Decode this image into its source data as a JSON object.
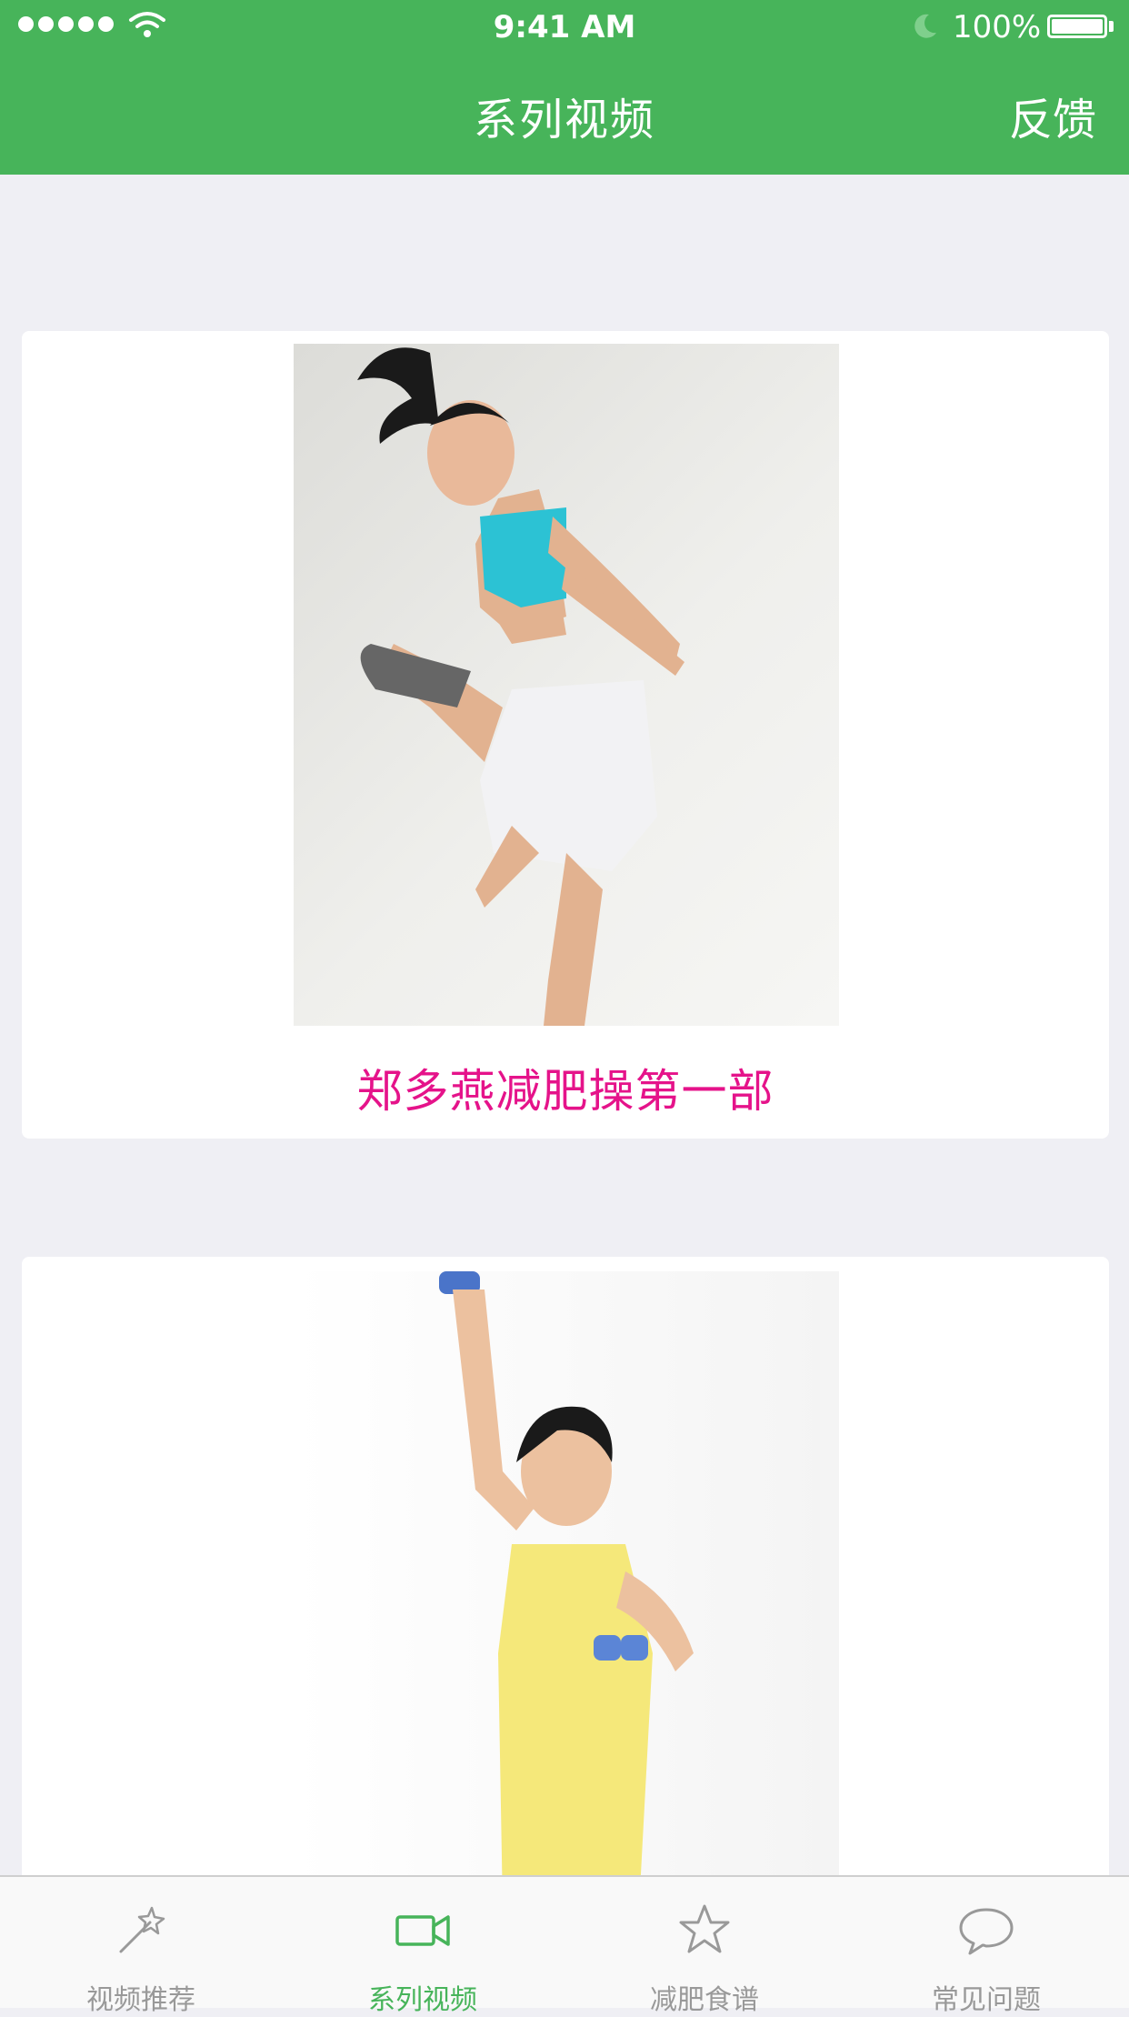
{
  "status_bar": {
    "time": "9:41 AM",
    "battery": "100%"
  },
  "nav": {
    "title": "系列视频",
    "action": "反馈"
  },
  "cards": [
    {
      "title": "郑多燕减肥操第一部"
    },
    {
      "title": ""
    }
  ],
  "tabs": [
    {
      "label": "视频推荐",
      "icon": "wand-icon"
    },
    {
      "label": "系列视频",
      "icon": "video-camera-icon",
      "active": true
    },
    {
      "label": "减肥食谱",
      "icon": "star-icon"
    },
    {
      "label": "常见问题",
      "icon": "chat-bubble-icon"
    }
  ],
  "colors": {
    "brand": "#47b45a",
    "title_pink": "#e5138a",
    "tab_inactive": "#999999"
  }
}
